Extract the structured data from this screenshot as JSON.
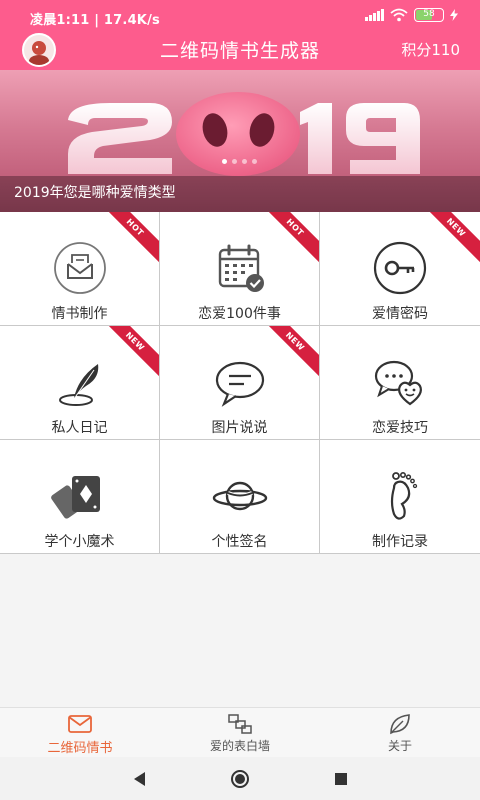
{
  "status_bar": {
    "time": "凌晨1:11 | 17.4K/s",
    "battery": "58"
  },
  "header": {
    "title": "二维码情书生成器",
    "points": "积分110"
  },
  "banner": {
    "caption": "2019年您是哪种爱情类型",
    "year_text": "2019",
    "slide_count": 4,
    "active_slide": 1
  },
  "features": [
    {
      "label": "情书制作",
      "icon": "envelope-icon",
      "badge": "HOT"
    },
    {
      "label": "恋爱100件事",
      "icon": "calendar-check-icon",
      "badge": "HOT"
    },
    {
      "label": "爱情密码",
      "icon": "key-icon",
      "badge": "NEW"
    },
    {
      "label": "私人日记",
      "icon": "quill-pen-icon",
      "badge": "NEW"
    },
    {
      "label": "图片说说",
      "icon": "chat-bubble-icon",
      "badge": "NEW"
    },
    {
      "label": "恋爱技巧",
      "icon": "chat-heart-icon",
      "badge": ""
    },
    {
      "label": "学个小魔术",
      "icon": "playing-cards-icon",
      "badge": ""
    },
    {
      "label": "个性签名",
      "icon": "planet-icon",
      "badge": ""
    },
    {
      "label": "制作记录",
      "icon": "footprint-icon",
      "badge": ""
    }
  ],
  "tabs": [
    {
      "label": "二维码情书",
      "icon": "envelope-icon",
      "active": true
    },
    {
      "label": "爱的表白墙",
      "icon": "wall-icon",
      "active": false
    },
    {
      "label": "关于",
      "icon": "leaf-icon",
      "active": false
    }
  ],
  "colors": {
    "header_bg": "#fd5c8d",
    "active_tab": "#e8663a",
    "badge": "#d6203f"
  }
}
